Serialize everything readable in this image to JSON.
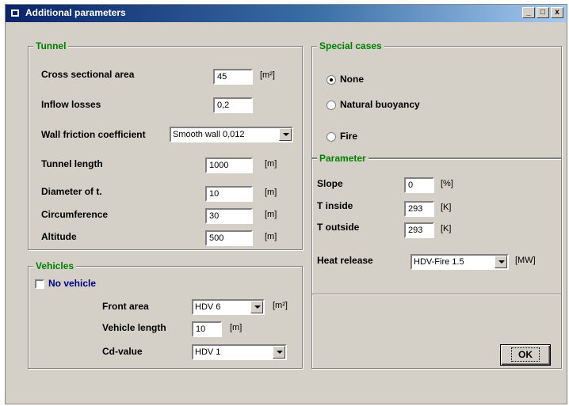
{
  "window": {
    "title": "Additional parameters",
    "controls": [
      "_",
      "□",
      "x"
    ]
  },
  "tunnel": {
    "legend": "Tunnel",
    "cross_sectional_area": {
      "label": "Cross sectional area",
      "value": "45",
      "unit": "[m²]"
    },
    "inflow_losses": {
      "label": "Inflow losses",
      "value": "0,2"
    },
    "wall_friction": {
      "label": "Wall friction coefficient",
      "selected": "Smooth wall 0,012"
    },
    "tunnel_length": {
      "label": "Tunnel length",
      "value": "1000",
      "unit": "[m]"
    },
    "diameter": {
      "label": "Diameter of t.",
      "value": "10",
      "unit": "[m]"
    },
    "circumference": {
      "label": "Circumference",
      "value": "30",
      "unit": "[m]"
    },
    "altitude": {
      "label": "Altitude",
      "value": "500",
      "unit": "[m]"
    }
  },
  "vehicles": {
    "legend": "Vehicles",
    "no_vehicle": {
      "label": "No vehicle",
      "checked": false
    },
    "front_area": {
      "label": "Front area",
      "selected": "HDV 6",
      "unit": "[m²]"
    },
    "vehicle_length": {
      "label": "Vehicle length",
      "value": "10",
      "unit": "[m]"
    },
    "cd_value": {
      "label": "Cd-value",
      "selected": "HDV 1"
    }
  },
  "special_cases": {
    "legend": "Special cases",
    "options": [
      {
        "label": "None",
        "selected": true
      },
      {
        "label": "Natural buoyancy",
        "selected": false
      },
      {
        "label": "Fire",
        "selected": false
      }
    ]
  },
  "parameter": {
    "legend": "Parameter",
    "slope": {
      "label": "Slope",
      "value": "0",
      "unit": "[%]"
    },
    "t_inside": {
      "label": "T inside",
      "value": "293",
      "unit": "[K]"
    },
    "t_outside": {
      "label": "T outside",
      "value": "293",
      "unit": "[K]"
    },
    "heat_release": {
      "label": "Heat release",
      "selected": "HDV-Fire 1.5",
      "unit": "[MW]"
    }
  },
  "ok_button": {
    "label": "OK"
  }
}
